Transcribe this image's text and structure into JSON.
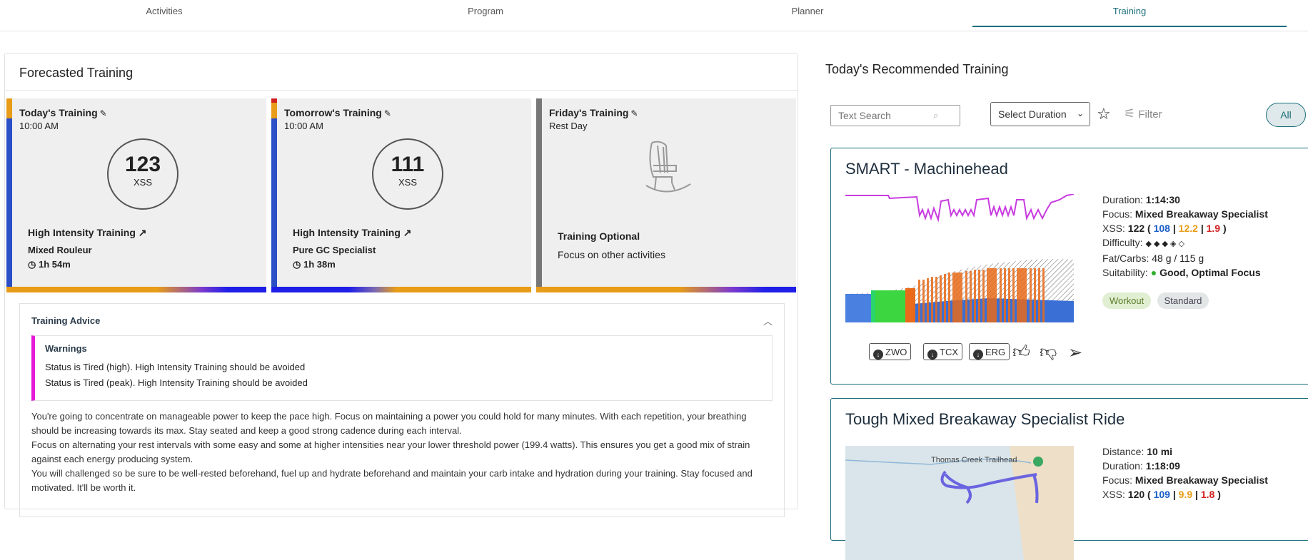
{
  "tabs": [
    "Activities",
    "Program",
    "Planner",
    "Training"
  ],
  "forecast": {
    "title": "Forecasted Training",
    "cards": [
      {
        "heading": "Today's Training",
        "time": "10:00 AM",
        "xss": "123",
        "xss_unit": "XSS",
        "type": "High Intensity Training",
        "focus": "Mixed Rouleur",
        "duration": "1h 54m"
      },
      {
        "heading": "Tomorrow's Training",
        "time": "10:00 AM",
        "xss": "111",
        "xss_unit": "XSS",
        "type": "High Intensity Training",
        "focus": "Pure GC Specialist",
        "duration": "1h 38m"
      },
      {
        "heading": "Friday's Training",
        "time": "Rest Day",
        "type": "Training Optional",
        "focus": "Focus on other activities"
      }
    ],
    "advice": {
      "title": "Training Advice",
      "warnings_title": "Warnings",
      "warnings": [
        "Status is Tired (high). High Intensity Training should be avoided",
        "Status is Tired (peak). High Intensity Training should be avoided"
      ],
      "paragraphs": [
        "You're going to concentrate on manageable power to keep the pace high. Focus on maintaining a power you could hold for many minutes. With each repetition, your breathing should be increasing towards its max. Stay seated and keep a good strong cadence during each interval.",
        "Focus on alternating your rest intervals with some easy and some at higher intensities near your lower threshold power (199.4 watts). This ensures you get a good mix of strain against each energy producing system.",
        "You will challenged so be sure to be well-rested beforehand, fuel up and hydrate beforehand and maintain your carb intake and hydration during your training. Stay focused and motivated. It'll be worth it."
      ]
    }
  },
  "recommended": {
    "title": "Today's Recommended Training",
    "search_placeholder": "Text Search",
    "duration_select": "Select Duration",
    "filter_label": "Filter",
    "all_label": "All",
    "workouts": [
      {
        "name": "SMART - Machinehead",
        "duration_label": "Duration:",
        "duration": "1:14:30",
        "focus_label": "Focus:",
        "focus": "Mixed Breakaway Specialist",
        "xss_label": "XSS:",
        "xss": "122",
        "xss_low": "108",
        "xss_high": "12.2",
        "xss_peak": "1.9",
        "difficulty_label": "Difficulty:",
        "difficulty": "◆ ◆ ◆ ◈ ◇",
        "fuel_label": "Fat/Carbs:",
        "fuel": "48 g / 115 g",
        "suitability_label": "Suitability:",
        "suitability": "Good, Optimal Focus",
        "tags": [
          "Workout",
          "Standard"
        ],
        "downloads": [
          "ZWO",
          "TCX",
          "ERG"
        ]
      },
      {
        "name": "Tough Mixed Breakaway Specialist Ride",
        "distance_label": "Distance:",
        "distance": "10 mi",
        "duration_label": "Duration:",
        "duration": "1:18:09",
        "focus_label": "Focus:",
        "focus": "Mixed Breakaway Specialist",
        "xss_label": "XSS:",
        "xss": "120",
        "xss_low": "109",
        "xss_high": "9.9",
        "xss_peak": "1.8",
        "map_label": "Thomas Creek Trailhead"
      }
    ]
  },
  "colors": {
    "accent": "#1a6e7a",
    "warning": "#e619d6",
    "xss_low": "#1a5ec7",
    "xss_high": "#e89c18",
    "xss_peak": "#d01f1f",
    "workout_line": "#c83be0"
  }
}
